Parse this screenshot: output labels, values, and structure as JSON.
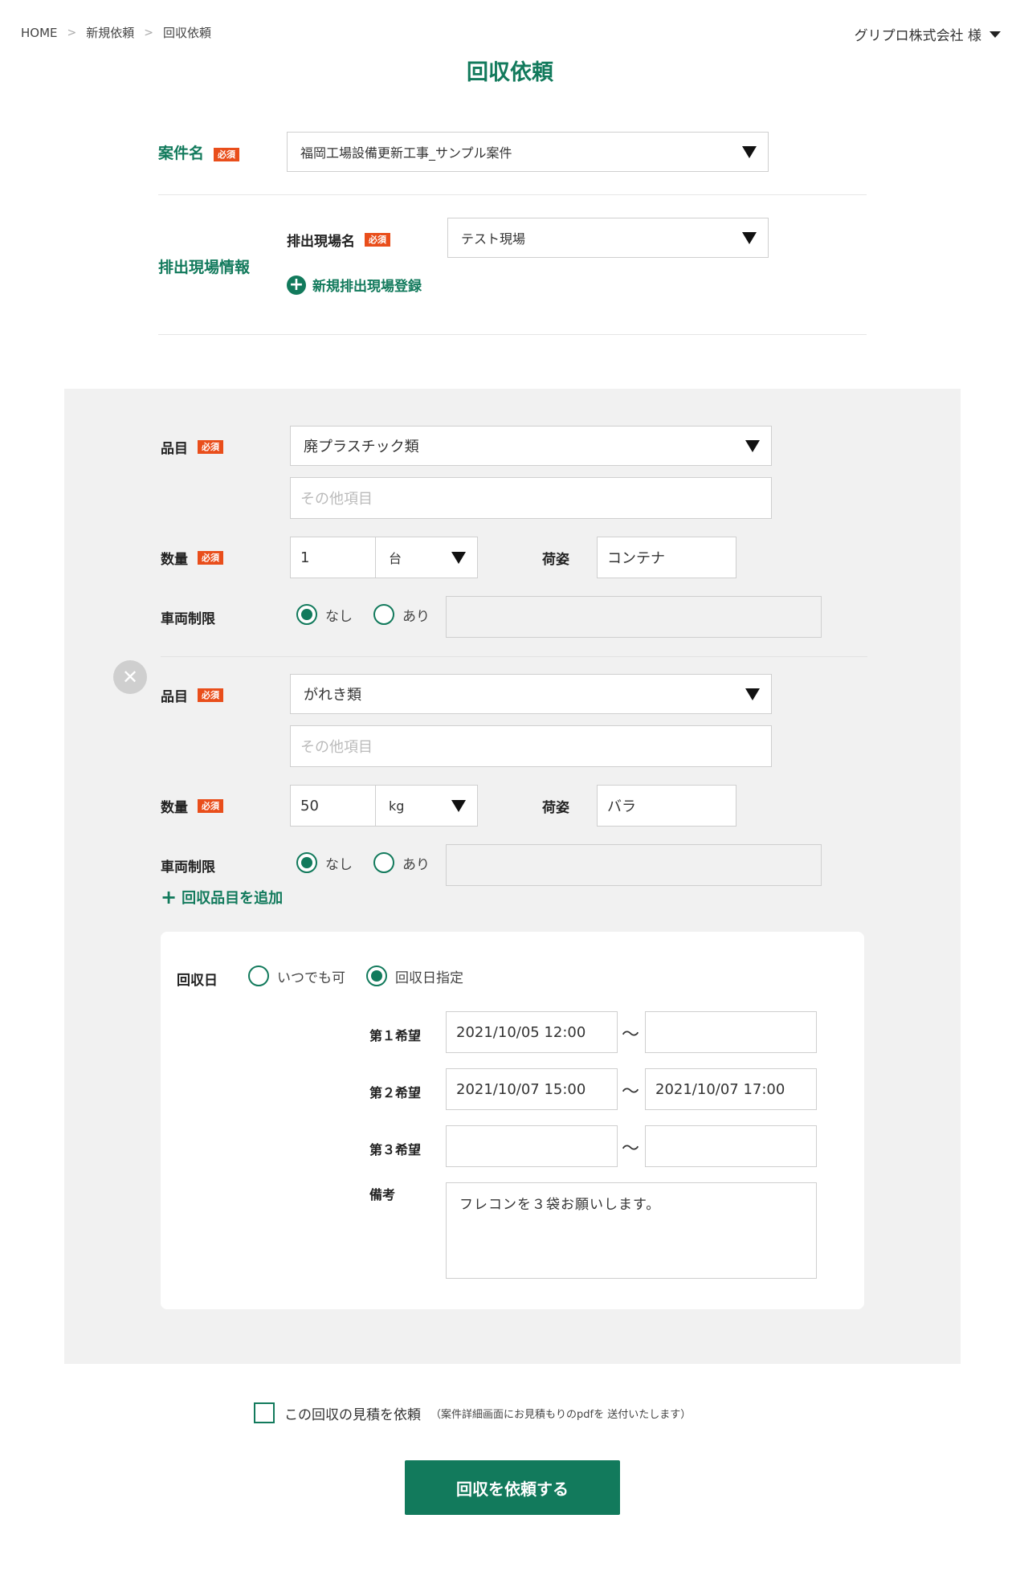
{
  "breadcrumb": [
    "HOME",
    "新規依頼",
    "回収依頼"
  ],
  "user": {
    "name": "グリプロ株式会社 様"
  },
  "page_title": "回収依頼",
  "required_badge": "必須",
  "project": {
    "label": "案件名",
    "value": "福岡工場設備更新工事_サンプル案件"
  },
  "site": {
    "section_label": "排出現場情報",
    "label": "排出現場名",
    "value": "テスト現場",
    "add_label": "新規排出現場登録"
  },
  "items": [
    {
      "item_label": "品目",
      "item_value": "廃プラスチック類",
      "other_placeholder": "その他項目",
      "qty_label": "数量",
      "qty_value": "1",
      "unit_value": "台",
      "packing_label": "荷姿",
      "packing_value": "コンテナ",
      "vehicle_label": "車両制限",
      "vehicle_options": [
        "なし",
        "あり"
      ],
      "vehicle_selected": "なし"
    },
    {
      "item_label": "品目",
      "item_value": "がれき類",
      "other_placeholder": "その他項目",
      "qty_label": "数量",
      "qty_value": "50",
      "unit_value": "kg",
      "packing_label": "荷姿",
      "packing_value": "バラ",
      "vehicle_label": "車両制限",
      "vehicle_options": [
        "なし",
        "あり"
      ],
      "vehicle_selected": "なし"
    }
  ],
  "add_item_label": "回収品目を追加",
  "collection": {
    "label": "回収日",
    "options": [
      "いつでも可",
      "回収日指定"
    ],
    "selected": "回収日指定",
    "preferences": [
      {
        "label": "第１希望",
        "from": "2021/10/05 12:00",
        "to": ""
      },
      {
        "label": "第２希望",
        "from": "2021/10/07 15:00",
        "to": "2021/10/07 17:00"
      },
      {
        "label": "第３希望",
        "from": "",
        "to": ""
      }
    ],
    "tilde": "〜",
    "remarks_label": "備考",
    "remarks_value": "フレコンを３袋お願いします。"
  },
  "quote": {
    "label": "この回収の見積を依頼",
    "note": "（案件詳細画面にお見積もりのpdfを 送付いたします）",
    "checked": false
  },
  "submit_label": "回収を依頼する",
  "colors": {
    "accent": "#127a5c",
    "badge": "#e94e1b",
    "panel": "#f1f1f1"
  }
}
